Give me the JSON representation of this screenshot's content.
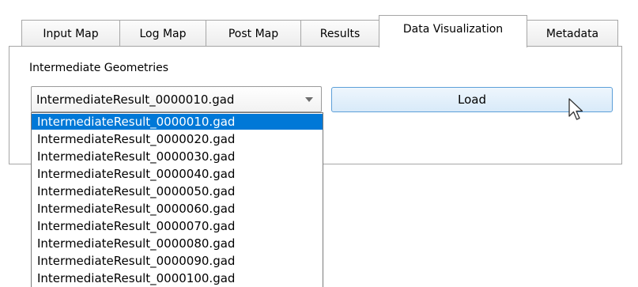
{
  "tabs": [
    {
      "label": "Input Map",
      "active": false
    },
    {
      "label": "Log Map",
      "active": false
    },
    {
      "label": "Post Map",
      "active": false
    },
    {
      "label": "Results",
      "active": false
    },
    {
      "label": "Data Visualization",
      "active": true
    },
    {
      "label": "Metadata",
      "active": false
    }
  ],
  "panel": {
    "group_label": "Intermediate Geometries",
    "combo_value": "IntermediateResult_0000010.gad",
    "load_label": "Load"
  },
  "dropdown": {
    "selected_index": 0,
    "options": [
      "IntermediateResult_0000010.gad",
      "IntermediateResult_0000020.gad",
      "IntermediateResult_0000030.gad",
      "IntermediateResult_0000040.gad",
      "IntermediateResult_0000050.gad",
      "IntermediateResult_0000060.gad",
      "IntermediateResult_0000070.gad",
      "IntermediateResult_0000080.gad",
      "IntermediateResult_0000090.gad",
      "IntermediateResult_0000100.gad"
    ]
  },
  "colors": {
    "selection": "#0078d7",
    "button_border": "#5c9fd8",
    "border": "#a6a6a6"
  }
}
